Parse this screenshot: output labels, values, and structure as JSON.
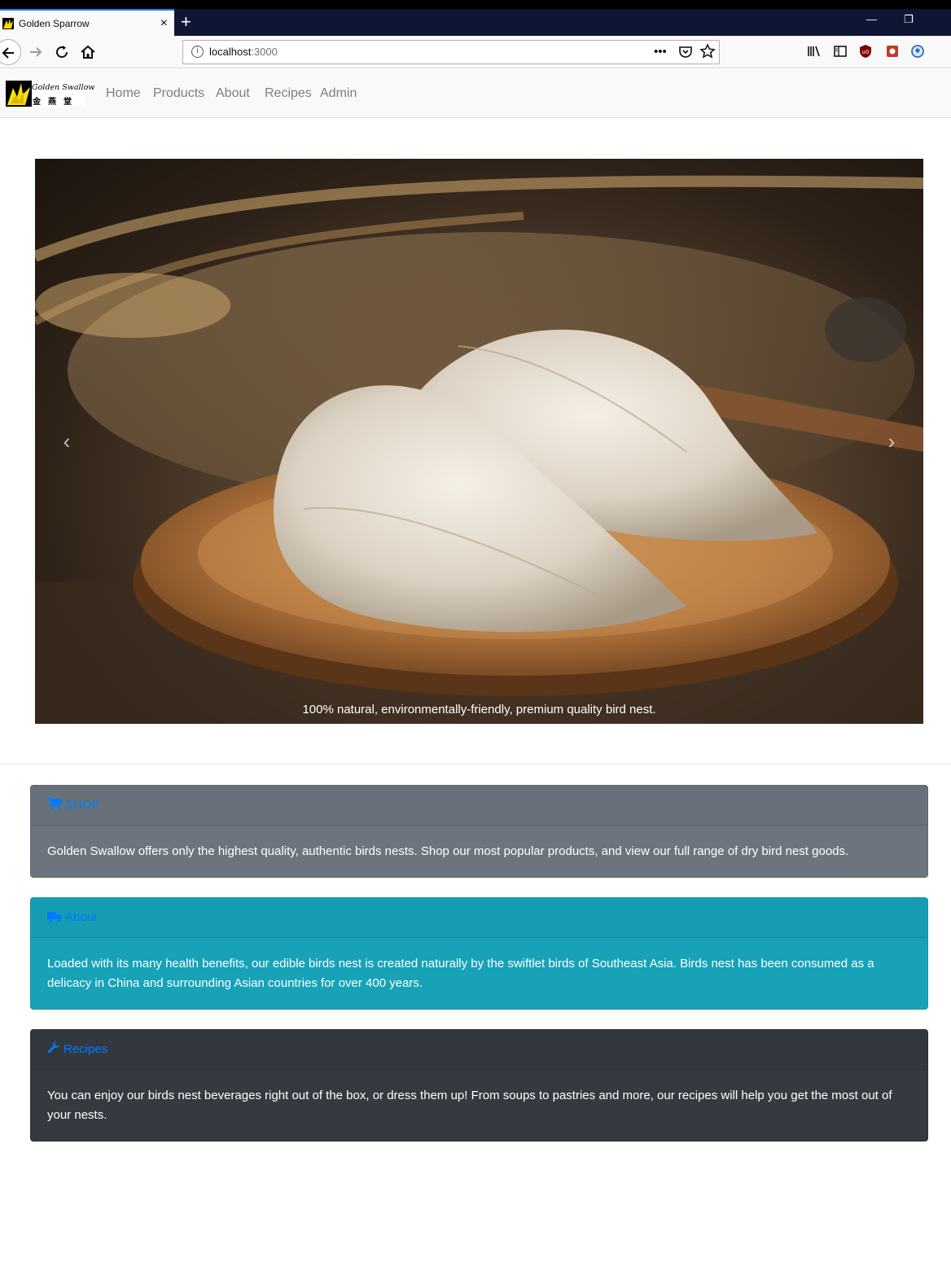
{
  "browser": {
    "tab_title": "Golden Sparrow",
    "tab_close": "×",
    "new_tab": "+",
    "url_host": "localhost",
    "url_port": ":3000",
    "url_more": "•••",
    "window_minimize": "—",
    "window_restore": "❐"
  },
  "site_nav": {
    "brand_en": "Golden Swallow",
    "brand_zh": "金燕堂",
    "links": [
      "Home",
      "Products",
      "About",
      "Recipes",
      "Admin"
    ]
  },
  "carousel": {
    "caption": "100% natural, environmentally-friendly, premium quality bird nest.",
    "prev": "‹",
    "next": "›"
  },
  "cards": [
    {
      "icon": "shopping-cart-icon",
      "title": "SHOP",
      "body": "Golden Swallow offers only the highest quality, authentic birds nests. Shop our most popular products, and view our full range of dry bird nest goods.",
      "color": "#6c757d"
    },
    {
      "icon": "truck-icon",
      "title": "About",
      "body": "Loaded with its many health benefits, our edible birds nest is created naturally by the swiftlet birds of Southeast Asia. Birds nest has been consumed as a delicacy in China and surrounding Asian countries for over 400 years.",
      "color": "#17a2b8"
    },
    {
      "icon": "wrench-icon",
      "title": "Recipes",
      "body": "You can enjoy our birds nest beverages right out of the box, or dress them up! From soups to pastries and more, our recipes will help you get the most out of your nests.",
      "color": "#343a40"
    }
  ],
  "colors": {
    "link_blue": "#007bff",
    "nav_bg": "#f8f9fa",
    "titlebar": "#0f1634"
  }
}
